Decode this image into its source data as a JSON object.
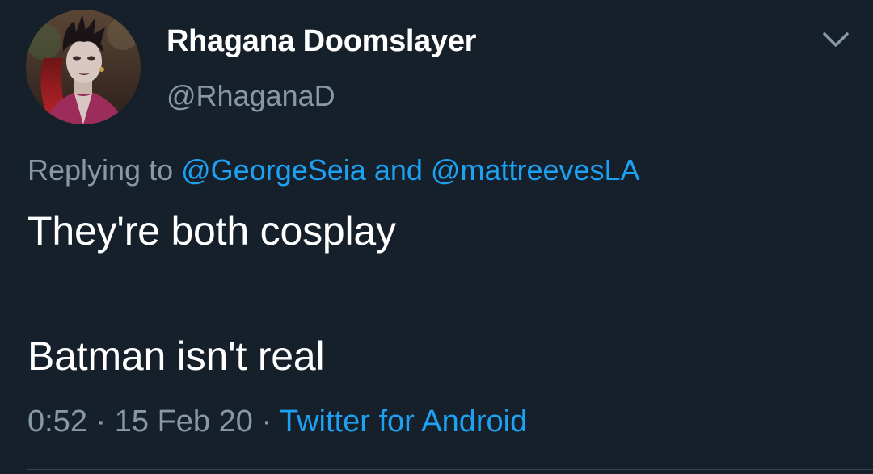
{
  "author": {
    "display_name": "Rhagana Doomslayer",
    "handle": "@RhaganaD",
    "avatar_icon": "character-portrait-avatar"
  },
  "reply": {
    "prefix": "Replying to",
    "user1": "@GeorgeSeia",
    "and": "and",
    "user2": "@mattreevesLA"
  },
  "tweet": {
    "line1": "They're both cosplay",
    "line2": "Batman isn't real"
  },
  "meta": {
    "time": "0:52",
    "sep1": "·",
    "date": "15 Feb 20",
    "sep2": "·",
    "source": "Twitter for Android"
  },
  "icons": {
    "menu": "chevron-down-icon"
  },
  "colors": {
    "background": "#15202b",
    "primary_text": "#ffffff",
    "secondary_text": "#8899a6",
    "accent_blue": "#1da1f2",
    "divider": "#38444d"
  }
}
